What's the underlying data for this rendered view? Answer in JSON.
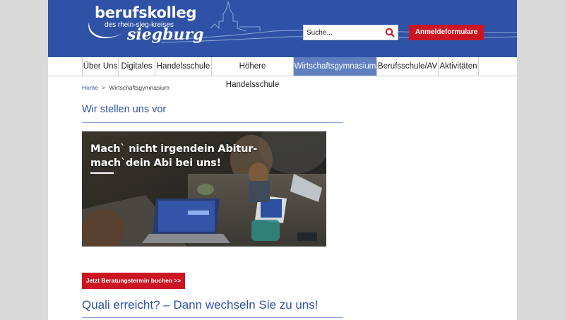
{
  "header": {
    "logo_main": "berufskolleg",
    "logo_sub": "des rhein-sieg-kreises",
    "logo_city": "siegburg",
    "search_placeholder": "Suche...",
    "search_icon": "search-icon",
    "register_button": "Anmeldeformulare",
    "colors": {
      "header_bg": "#2f52a6",
      "accent_red": "#cc1522",
      "nav_active": "#5f7fc0"
    }
  },
  "nav": {
    "items": [
      {
        "label": "Über Uns"
      },
      {
        "label": "Digitales"
      },
      {
        "label": "Handelsschule"
      },
      {
        "label": "Höhere Handelsschule"
      },
      {
        "label": "Wirtschaftsgymnasium",
        "active": true
      },
      {
        "label": "Berufsschule/AV"
      },
      {
        "label": "Aktivitäten"
      }
    ]
  },
  "breadcrumb": {
    "home": "Home",
    "separator": ">",
    "current": "Wirtschaftsgymnasium"
  },
  "main": {
    "heading_1": "Wir stellen uns vor",
    "banner_line_1": "Mach` nicht irgendein Abitur-",
    "banner_line_2": "mach`dein Abi bei uns!",
    "cta_button": "Jetzt Beratungstermin buchen >>",
    "heading_2": "Quali erreicht? – Dann wechseln Sie zu uns!"
  }
}
